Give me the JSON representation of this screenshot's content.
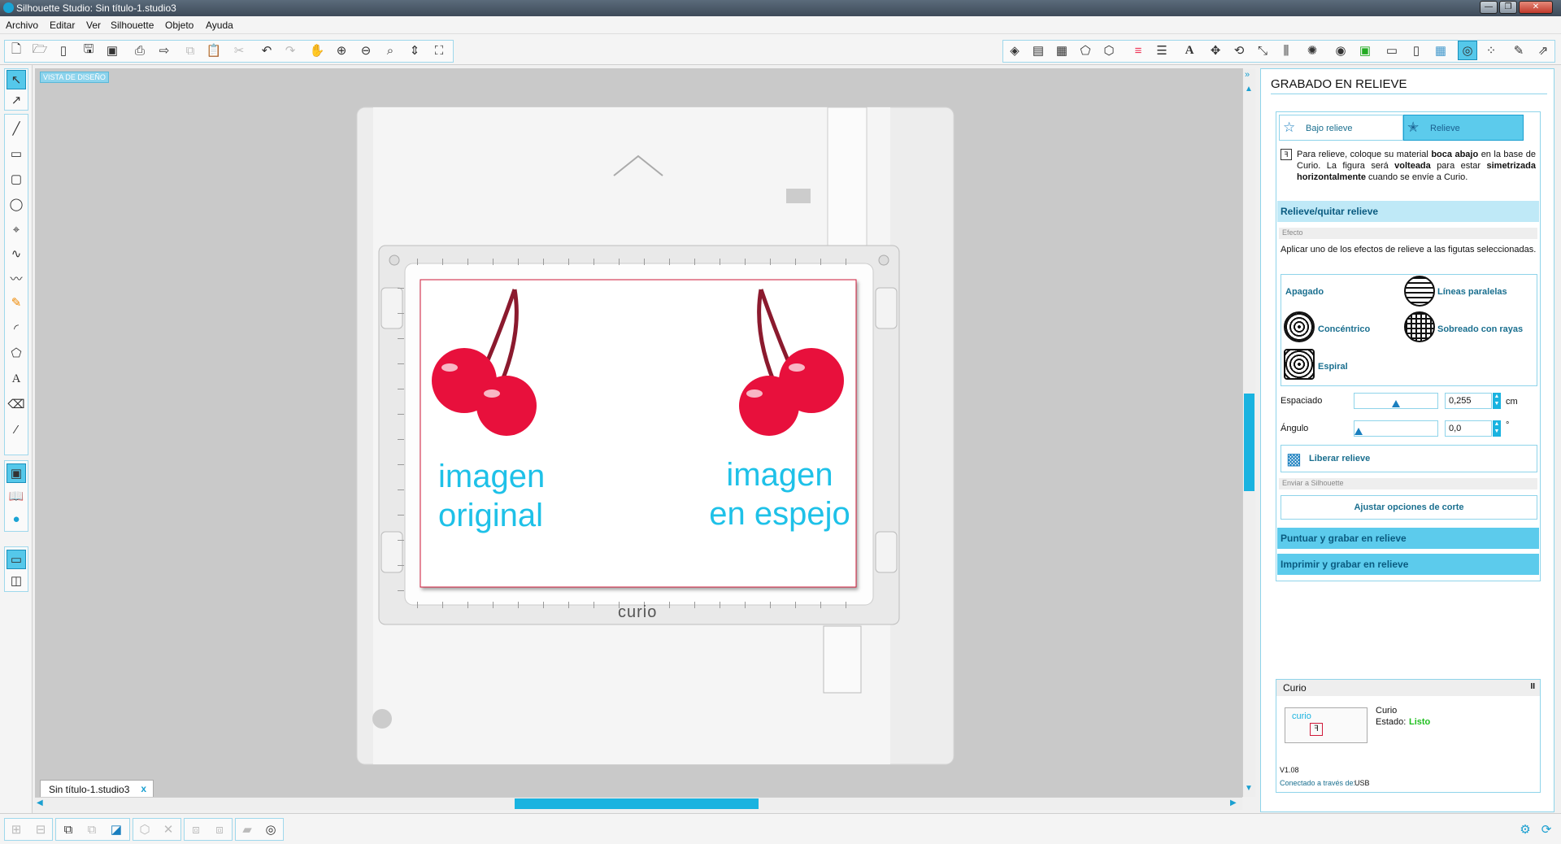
{
  "window": {
    "title": "Silhouette Studio: Sin título-1.studio3",
    "controls": [
      "—",
      "❐",
      "✕"
    ]
  },
  "menu": [
    "Archivo",
    "Editar",
    "Ver",
    "Silhouette",
    "Objeto",
    "Ayuda"
  ],
  "canvas": {
    "view_label": "VISTA DE DISEÑO",
    "mat_brand": "curio",
    "text_left": [
      "imagen",
      "original"
    ],
    "text_right": [
      "imagen",
      "en espejo"
    ],
    "doc_tab": "Sin título-1.studio3",
    "doc_tab_close": "x"
  },
  "panel": {
    "title": "GRABADO EN RELIEVE",
    "tab_low": "Bajo relieve",
    "tab_relief": "Relieve",
    "info_parts": [
      "Para relieve, coloque su material ",
      "boca abajo",
      " en la base de Curio. La figura será ",
      "volteada",
      " para estar ",
      "simetrizada horizontalmente",
      " cuando se envíe a Curio."
    ],
    "section1": "Relieve/quitar relieve",
    "effect_header": "Efecto",
    "effect_desc": "Aplicar uno de los efectos de relieve a las figutas seleccionadas.",
    "effects": {
      "off": "Apagado",
      "parallel": "Líneas paralelas",
      "concentric": "Concéntrico",
      "crosshatch": "Sobreado con rayas",
      "spiral": "Espiral"
    },
    "spacing_label": "Espaciado",
    "spacing_value": "0,255",
    "spacing_unit": "cm",
    "angle_label": "Ángulo",
    "angle_value": "0,0",
    "angle_unit": "°",
    "release_button": "Liberar relieve",
    "send_header": "Enviar a Silhouette",
    "cut_options_button": "Ajustar opciones de corte",
    "section2": "Puntuar y grabar en relieve",
    "section3": "Imprimir y grabar en relieve"
  },
  "device": {
    "header": "Curio",
    "pause": "II",
    "name": "Curio",
    "status_label": "Estado:",
    "status_value": "Listo",
    "status_color": "#1fbf1f",
    "thumb_label": "curio",
    "version": "V1.08",
    "conn_label": "Conectado a través de:",
    "conn_value": "USB"
  },
  "colors": {
    "accent": "#5ccbec",
    "cherry": "#e8103c",
    "stem": "#8b1a2e",
    "text_cyan": "#1ec1e8"
  }
}
